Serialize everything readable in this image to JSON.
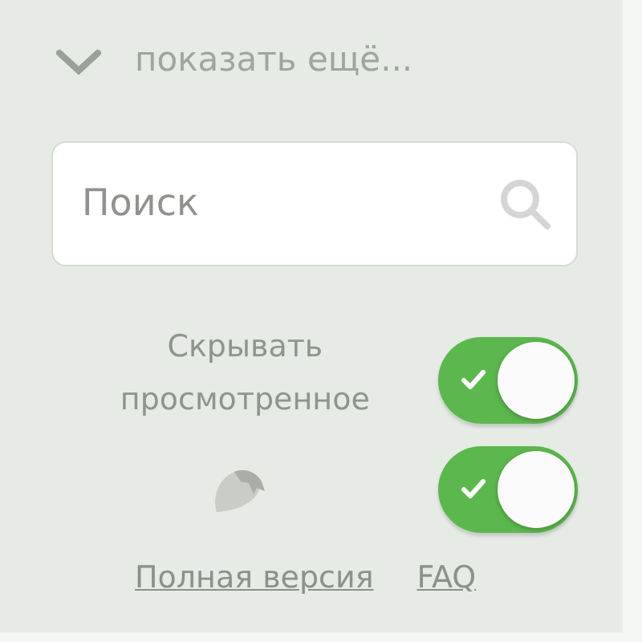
{
  "expander": {
    "label": "показать ещё...",
    "expanded": false
  },
  "search": {
    "placeholder": "Поиск"
  },
  "toggles": [
    {
      "kind": "label",
      "label": "Скрывать просмотренное",
      "on": true
    },
    {
      "kind": "icon",
      "on": true
    }
  ],
  "links": [
    "Полная версия",
    "FAQ"
  ]
}
